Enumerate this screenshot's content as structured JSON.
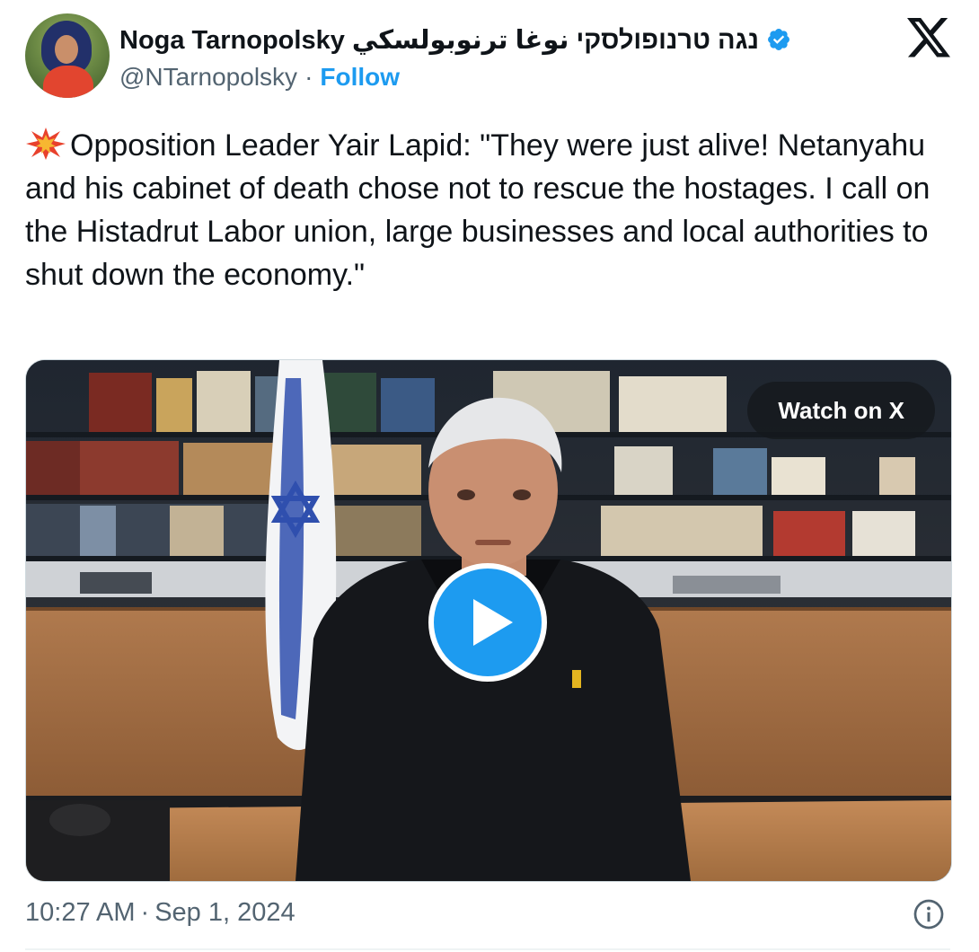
{
  "author": {
    "display_name": "Noga Tarnopolsky נגה טרנופולסקי نوغا ترنوبولسكي",
    "handle": "@NTarnopolsky",
    "separator": "·",
    "follow_label": "Follow",
    "verified_icon": "verified-badge-icon",
    "avatar_icon": "user-avatar"
  },
  "brand": {
    "icon": "x-logo-icon"
  },
  "tweet": {
    "emoji": "collision-emoji",
    "text": "Opposition Leader Yair Lapid: \"They were just alive! Netanyahu and his cabinet of death chose not to rescue the hostages. I call on the Histadrut Labor union, large businesses and local authorities to shut down the economy.\""
  },
  "media": {
    "watch_label": "Watch on X",
    "play_icon": "play-icon"
  },
  "footer": {
    "time": "10:27 AM",
    "separator": "·",
    "date": "Sep 1, 2024",
    "info_icon": "info-icon"
  },
  "colors": {
    "accent": "#1d9bf0",
    "text": "#0f1419",
    "muted": "#536471"
  }
}
